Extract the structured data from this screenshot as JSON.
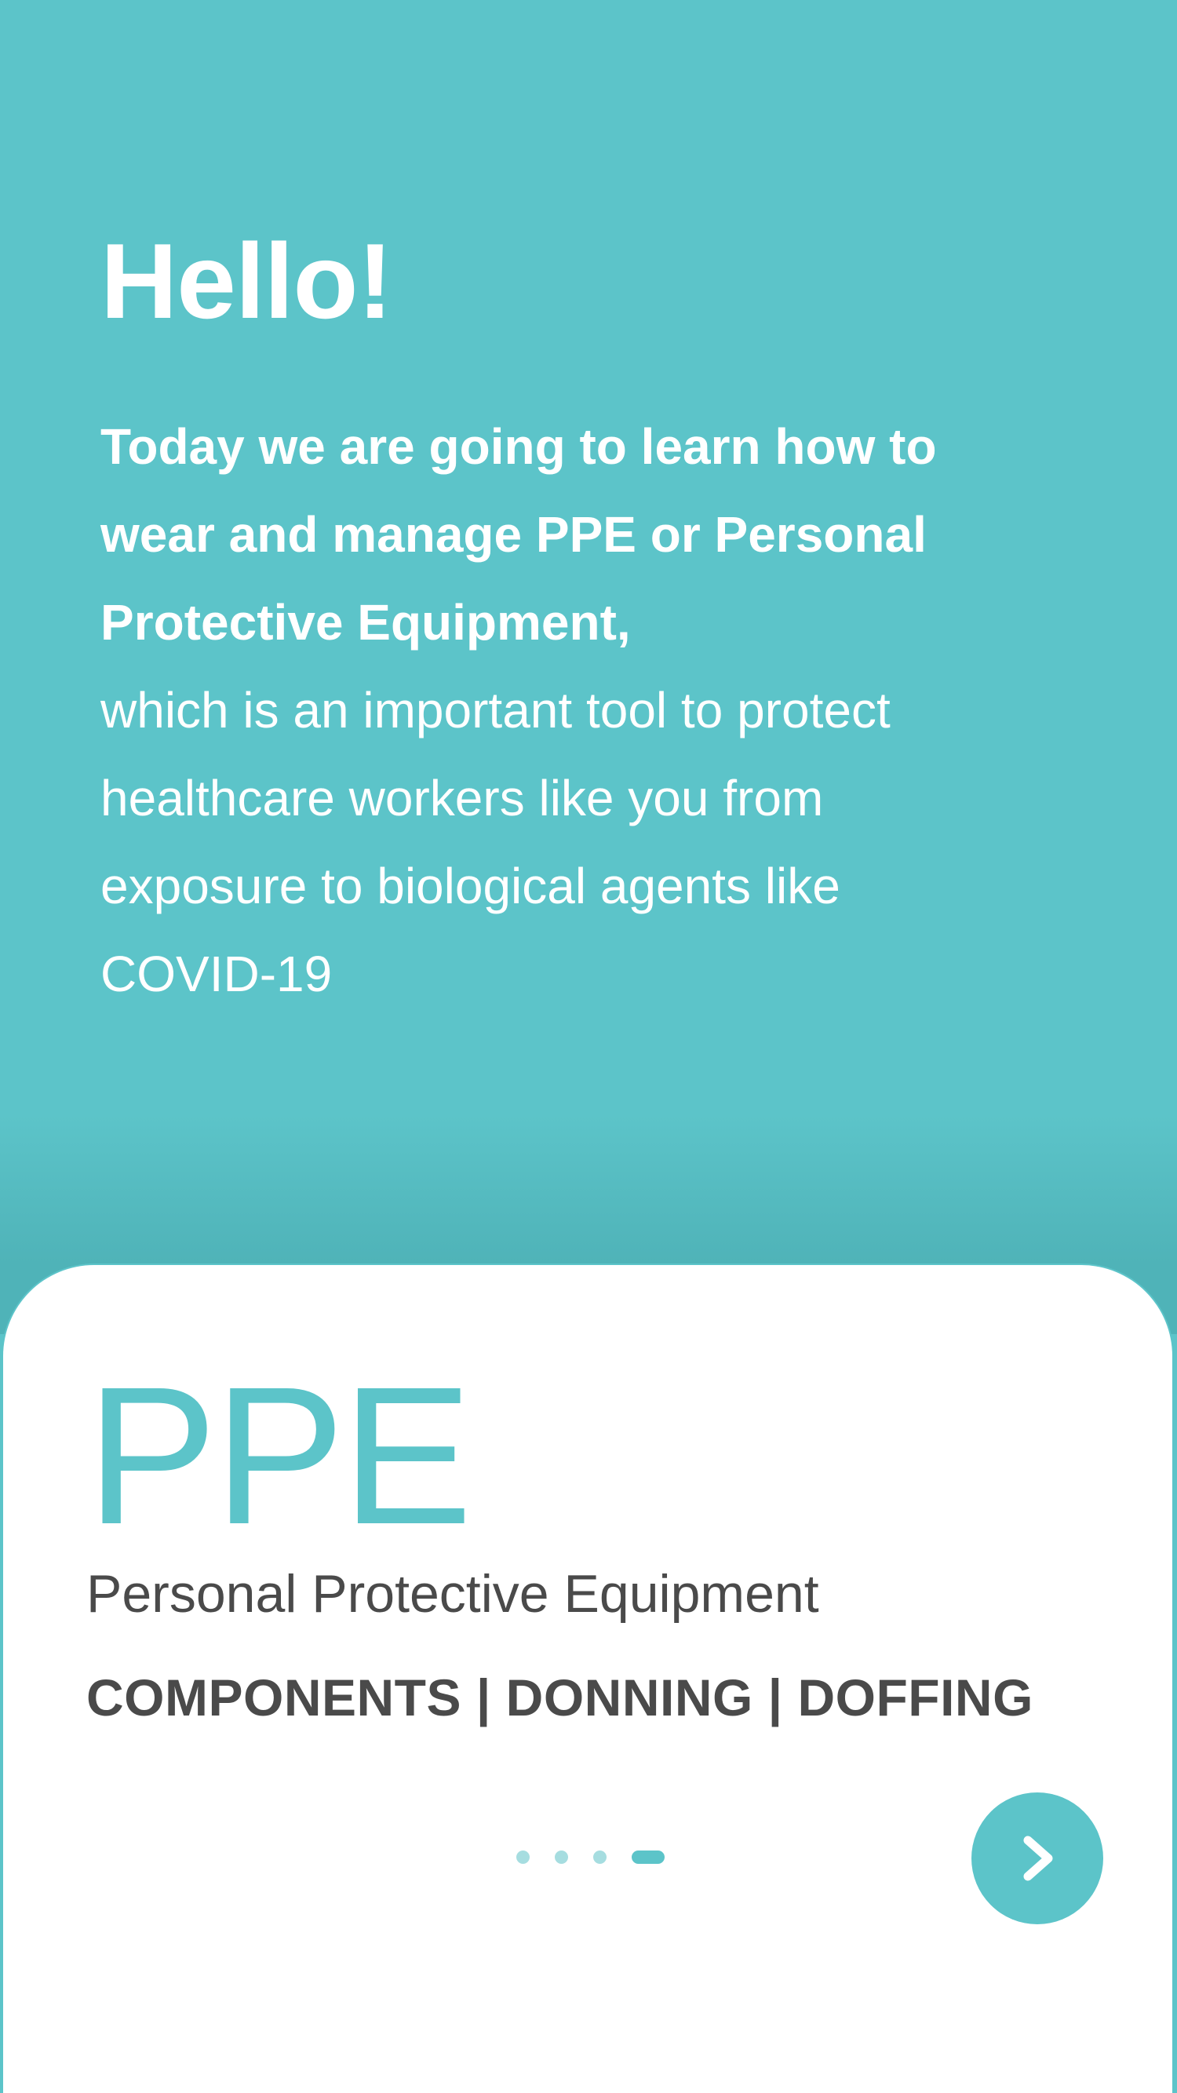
{
  "intro": {
    "greeting": "Hello!",
    "bold_text": "Today we are going to learn how to wear and manage PPE or Personal Protective Equipment,",
    "body_text": "which is an important tool to protect healthcare workers like you from exposure to biological agents like COVID-19"
  },
  "card": {
    "title": "PPE",
    "subtitle": "Personal Protective Equipment",
    "topics": "COMPONENTS | DONNING | DOFFING"
  },
  "pager": {
    "total": 4,
    "current": 4
  },
  "next_button": {
    "icon": "chevron-right-icon"
  },
  "colors": {
    "accent": "#5CC4C9",
    "text_dark": "#4A4A4A",
    "dot_inactive": "#A6DDE0"
  }
}
